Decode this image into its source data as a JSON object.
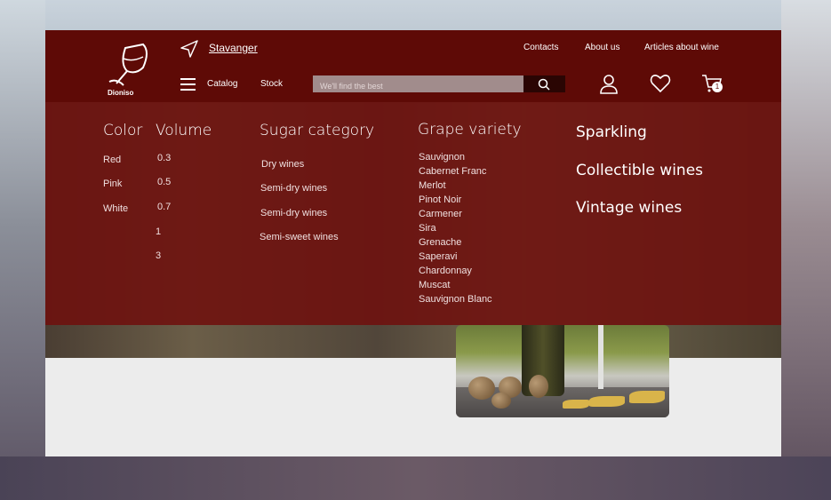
{
  "brand": {
    "name": "Dioniso"
  },
  "location": {
    "city": "Stavanger"
  },
  "top_links": [
    "Contacts",
    "About us",
    "Articles about wine"
  ],
  "nav": {
    "catalog": "Catalog",
    "stock": "Stock"
  },
  "search": {
    "placeholder": "We'll find the best"
  },
  "cart": {
    "count": "1"
  },
  "menu": {
    "color": {
      "title": "Color",
      "items": [
        "Red",
        "Pink",
        "White"
      ]
    },
    "volume": {
      "title": "Volume",
      "items": [
        "0.3",
        "0.5",
        "0.7",
        "1",
        "3"
      ]
    },
    "sugar": {
      "title": "Sugar category",
      "items": [
        "Dry wines",
        "Semi-dry wines",
        "Semi-dry wines",
        "Semi-sweet wines"
      ]
    },
    "grape": {
      "title": "Grape variety",
      "items": [
        "Sauvignon",
        "Cabernet Franc",
        "Merlot",
        "Pinot Noir",
        "Carmener",
        "Sira",
        "Grenache",
        "Saperavi",
        "Chardonnay",
        "Muscat",
        "Sauvignon Blanc"
      ]
    },
    "extra": [
      "Sparkling",
      "Collectible wines",
      "Vintage wines"
    ]
  },
  "colors": {
    "header": "#5e0a06",
    "overlay": "#6e100e",
    "search": "#a18c8c"
  }
}
